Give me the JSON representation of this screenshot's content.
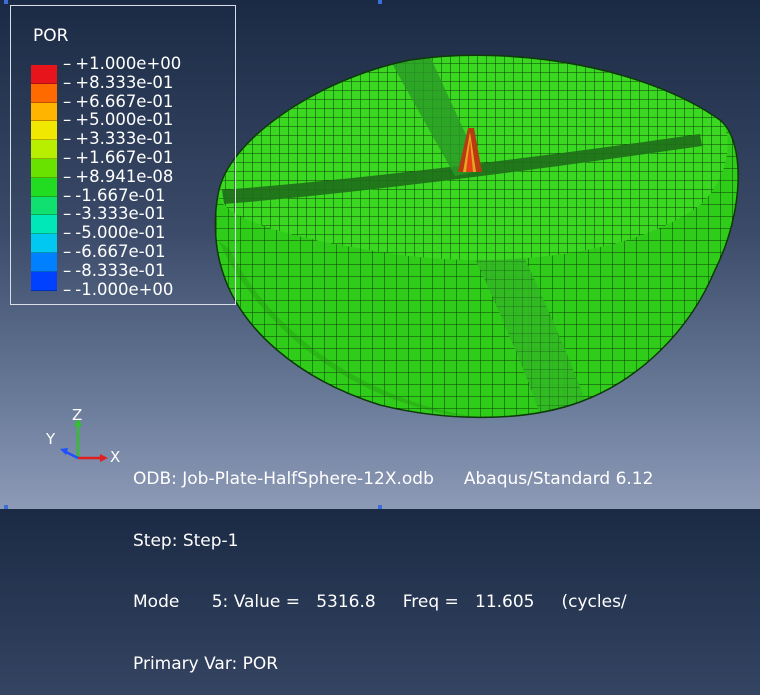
{
  "legend": {
    "variable": "POR",
    "colors": [
      "#e8141c",
      "#ff6a00",
      "#ffb400",
      "#f0e800",
      "#b8ee00",
      "#6ae200",
      "#22dc22",
      "#10e070",
      "#00e8b8",
      "#00c8f0",
      "#0080ff",
      "#0040ff",
      "#0008e8"
    ],
    "ticks": [
      "+1.000e+00",
      "+8.333e-01",
      "+6.667e-01",
      "+5.000e-01",
      "+3.333e-01",
      "+1.667e-01",
      "+8.941e-08",
      "-1.667e-01",
      "-3.333e-01",
      "-5.000e-01",
      "-6.667e-01",
      "-8.333e-01",
      "-1.000e+00"
    ]
  },
  "triad": {
    "x": "X",
    "y": "Y",
    "z": "Z"
  },
  "info": {
    "odb": "ODB: Job-Plate-HalfSphere-12X.odb",
    "solver": "Abaqus/Standard 6.12",
    "step": "Step: Step-1",
    "mode": "Mode      5: Value =   5316.8     Freq =   11.605     (cycles/",
    "primary_var": "Primary Var: POR"
  },
  "colors": {
    "mesh_fill": "#35d81e",
    "mesh_line": "#0c3a08",
    "seam": "#2a8a2a"
  }
}
